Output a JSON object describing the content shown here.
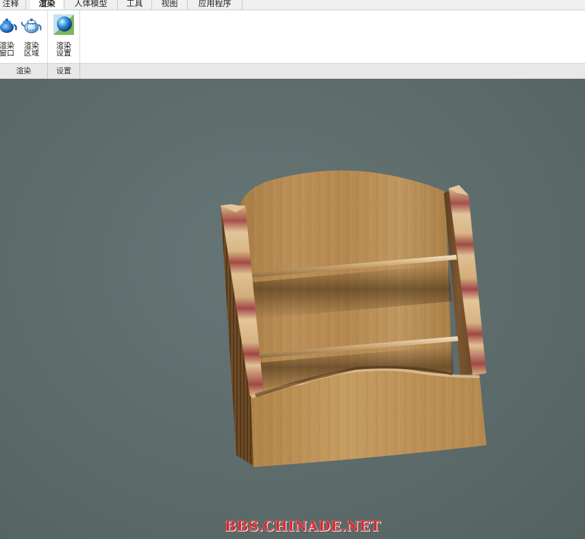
{
  "tabs": [
    {
      "label": "注释",
      "active": false
    },
    {
      "label": "渲染",
      "active": true
    },
    {
      "label": "人体模型",
      "active": false
    },
    {
      "label": "工具",
      "active": false
    },
    {
      "label": "视图",
      "active": false
    },
    {
      "label": "应用程序",
      "active": false
    }
  ],
  "ribbon": {
    "render_window": {
      "label": "渲染\n窗口",
      "icon": "teapot-icon"
    },
    "render_region": {
      "label": "渲染\n区域",
      "icon": "teapot-region-icon"
    },
    "render_settings": {
      "label": "渲染\n设置",
      "icon": "sphere-icon"
    },
    "groups": {
      "render": "渲染",
      "settings": "设置"
    }
  },
  "viewport": {
    "background_color": "#5c6a6b",
    "model": "wooden-display-rack"
  },
  "watermark": "BBS.CHINADE.NET"
}
